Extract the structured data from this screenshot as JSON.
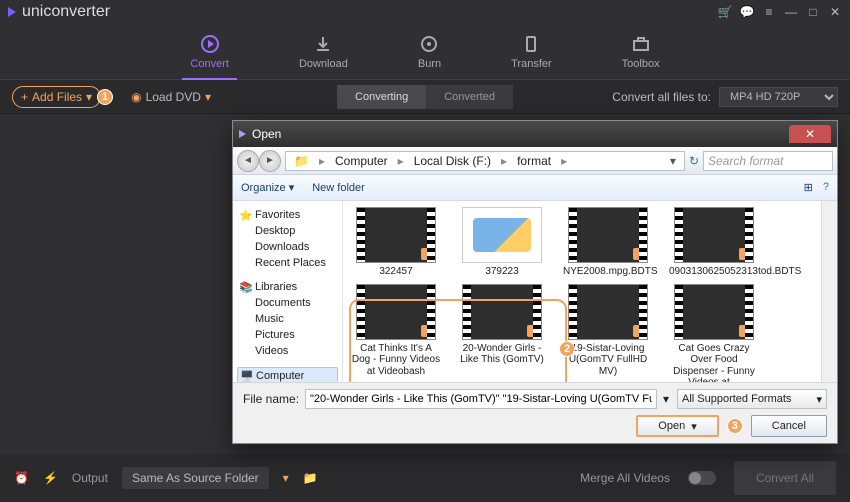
{
  "app": {
    "name": "uniconverter"
  },
  "window_icons": {
    "cart": "🛒",
    "chat": "💬",
    "menu": "≡",
    "min": "—",
    "max": "□",
    "close": "✕"
  },
  "tabs": [
    {
      "label": "Convert",
      "active": true
    },
    {
      "label": "Download",
      "active": false
    },
    {
      "label": "Burn",
      "active": false
    },
    {
      "label": "Transfer",
      "active": false
    },
    {
      "label": "Toolbox",
      "active": false
    }
  ],
  "toolbar": {
    "addfiles": "Add Files",
    "loaddvd": "Load DVD",
    "seg_converting": "Converting",
    "seg_converted": "Converted",
    "convertall_label": "Convert all files to:",
    "convertall_value": "MP4 HD 720P"
  },
  "bottom": {
    "output_label": "Output",
    "output_value": "Same As Source Folder",
    "merge_label": "Merge All Videos",
    "convertall_btn": "Convert All"
  },
  "annotations": {
    "a1": "1",
    "a2": "2",
    "a3": "3"
  },
  "dialog": {
    "title": "Open",
    "crumbs": [
      "Computer",
      "Local Disk (F:)",
      "format"
    ],
    "search_placeholder": "Search format",
    "refresh_icon": "↻",
    "organize": "Organize",
    "newfolder": "New folder",
    "views_icon": "⊞",
    "help_icon": "?",
    "sidebar": {
      "favorites": {
        "label": "Favorites",
        "items": [
          "Desktop",
          "Downloads",
          "Recent Places"
        ]
      },
      "libraries": {
        "label": "Libraries",
        "items": [
          "Documents",
          "Music",
          "Pictures",
          "Videos"
        ]
      },
      "computer": {
        "label": "Computer"
      }
    },
    "files": [
      {
        "name": "322457",
        "type": "video"
      },
      {
        "name": "379223",
        "type": "doc"
      },
      {
        "name": "NYE2008.mpg.BDTS",
        "type": "video"
      },
      {
        "name": "0903130625052313tod.BDTS",
        "type": "video"
      },
      {
        "name": "Cat Thinks It's A Dog - Funny Videos at Videobash",
        "type": "video"
      },
      {
        "name": "20-Wonder Girls - Like This (GomTV)",
        "type": "video",
        "selected": true
      },
      {
        "name": "19-Sistar-Loving U(GomTV FullHD MV)",
        "type": "video",
        "selected": true
      },
      {
        "name": "Cat Goes Crazy Over Food Dispenser - Funny Videos at…",
        "type": "video"
      }
    ],
    "filename_label": "File name:",
    "filename_value": "\"20-Wonder Girls - Like This (GomTV)\" \"19-Sistar-Loving U(GomTV Fu",
    "format_filter": "All Supported Formats",
    "open_btn": "Open",
    "cancel_btn": "Cancel"
  }
}
